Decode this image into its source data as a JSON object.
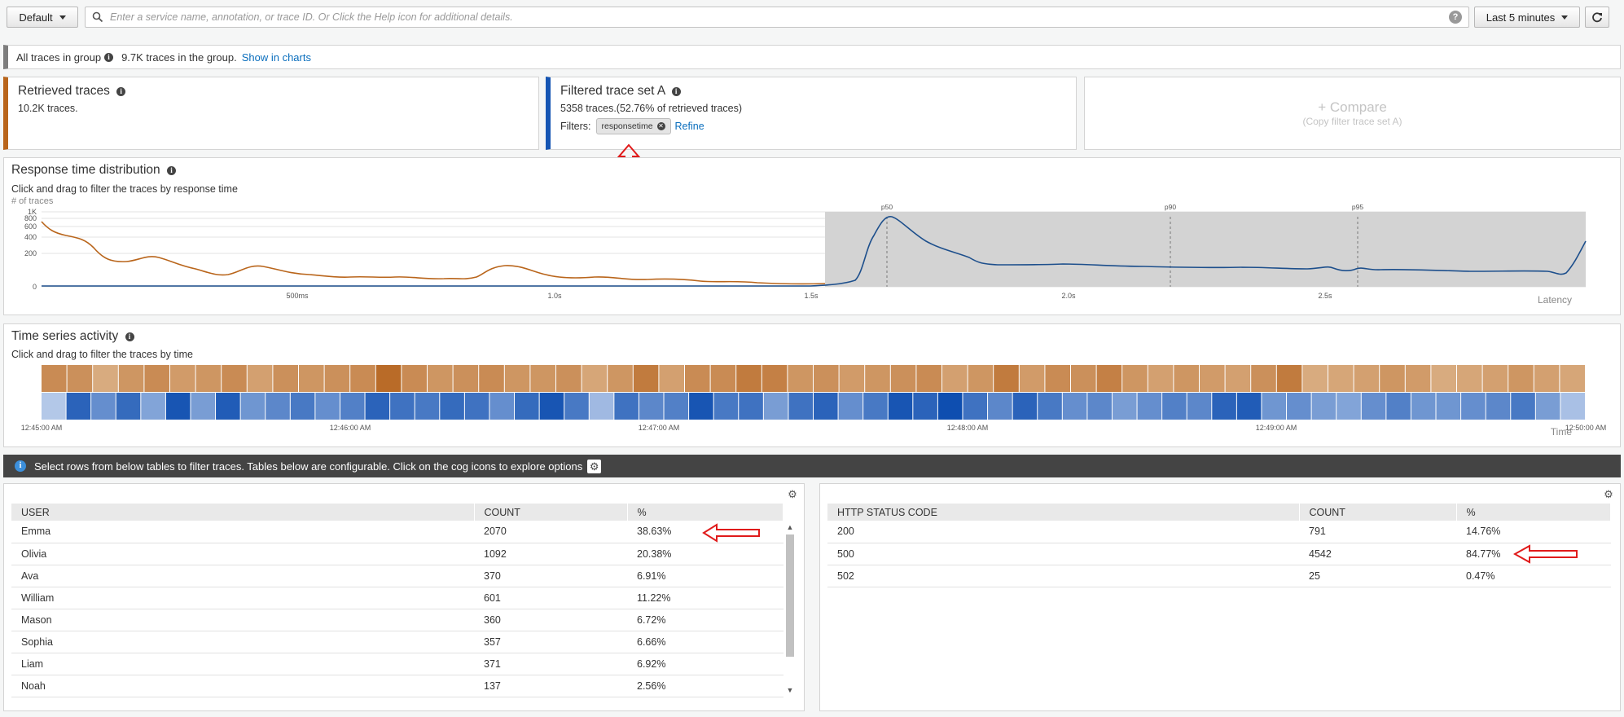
{
  "toolbar": {
    "group_label": "Default",
    "search_placeholder": "Enter a service name, annotation, or trace ID. Or Click the Help icon for additional details.",
    "help_label": "?",
    "time_range_label": "Last 5 minutes"
  },
  "group_bar": {
    "label": "All traces in group",
    "count_text": "9.7K traces in the group.",
    "link": "Show in charts"
  },
  "retrieved": {
    "title": "Retrieved traces",
    "count_text": "10.2K traces."
  },
  "filtered": {
    "title": "Filtered trace set A",
    "count_text": "5358 traces.(52.76% of retrieved traces)",
    "filters_label": "Filters:",
    "filter_chip": "responsetime",
    "refine_link": "Refine"
  },
  "compare": {
    "label": "+ Compare",
    "sub": "(Copy filter trace set A)"
  },
  "response_dist": {
    "title": "Response time distribution",
    "hint": "Click and drag to filter the traces by response time",
    "ylabel": "# of traces",
    "xlabel": "Latency",
    "yticks": [
      "1K",
      "800",
      "600",
      "400",
      "200",
      "0"
    ],
    "xticks": [
      "500ms",
      "1.0s",
      "1.5s",
      "2.0s",
      "2.5s"
    ],
    "percentiles": [
      "p50",
      "p90",
      "p95"
    ],
    "colors": {
      "retrieved": "#b9651b",
      "filtered": "#1d4f8c"
    }
  },
  "time_series": {
    "title": "Time series activity",
    "hint": "Click and drag to filter the traces by time",
    "xlabel": "Time",
    "xticks": [
      "12:45:00 AM",
      "12:46:00 AM",
      "12:47:00 AM",
      "12:48:00 AM",
      "12:49:00 AM",
      "12:50:00 AM"
    ],
    "retrieved_levels": [
      0.6,
      0.55,
      0.3,
      0.5,
      0.6,
      0.45,
      0.5,
      0.6,
      0.4,
      0.55,
      0.5,
      0.55,
      0.6,
      0.9,
      0.6,
      0.5,
      0.55,
      0.6,
      0.5,
      0.5,
      0.55,
      0.35,
      0.5,
      0.75,
      0.4,
      0.6,
      0.6,
      0.75,
      0.7,
      0.5,
      0.55,
      0.45,
      0.5,
      0.55,
      0.6,
      0.4,
      0.5,
      0.75,
      0.45,
      0.6,
      0.55,
      0.7,
      0.5,
      0.4,
      0.5,
      0.45,
      0.4,
      0.55,
      0.75,
      0.3,
      0.35,
      0.4,
      0.5,
      0.45,
      0.3,
      0.35,
      0.4,
      0.5,
      0.4,
      0.35
    ],
    "filtered_levels": [
      0.15,
      0.85,
      0.55,
      0.8,
      0.4,
      0.95,
      0.45,
      0.9,
      0.5,
      0.6,
      0.7,
      0.55,
      0.65,
      0.85,
      0.75,
      0.7,
      0.8,
      0.75,
      0.55,
      0.8,
      0.95,
      0.7,
      0.25,
      0.75,
      0.6,
      0.65,
      0.95,
      0.7,
      0.75,
      0.45,
      0.75,
      0.85,
      0.55,
      0.7,
      0.95,
      0.85,
      1.0,
      0.75,
      0.6,
      0.85,
      0.7,
      0.55,
      0.6,
      0.45,
      0.55,
      0.65,
      0.6,
      0.85,
      0.9,
      0.5,
      0.55,
      0.45,
      0.4,
      0.55,
      0.65,
      0.5,
      0.5,
      0.55,
      0.6,
      0.7,
      0.45,
      0.2
    ]
  },
  "info_bar": {
    "text": "Select rows from below tables to filter traces. Tables below are configurable. Click on the cog icons to explore options"
  },
  "user_table": {
    "headers": [
      "USER",
      "COUNT",
      "%"
    ],
    "rows": [
      {
        "name": "Emma",
        "count": "2070",
        "pct": "38.63%"
      },
      {
        "name": "Olivia",
        "count": "1092",
        "pct": "20.38%"
      },
      {
        "name": "Ava",
        "count": "370",
        "pct": "6.91%"
      },
      {
        "name": "William",
        "count": "601",
        "pct": "11.22%"
      },
      {
        "name": "Mason",
        "count": "360",
        "pct": "6.72%"
      },
      {
        "name": "Sophia",
        "count": "357",
        "pct": "6.66%"
      },
      {
        "name": "Liam",
        "count": "371",
        "pct": "6.92%"
      },
      {
        "name": "Noah",
        "count": "137",
        "pct": "2.56%"
      }
    ]
  },
  "status_table": {
    "headers": [
      "HTTP STATUS CODE",
      "COUNT",
      "%"
    ],
    "rows": [
      {
        "code": "200",
        "count": "791",
        "pct": "14.76%"
      },
      {
        "code": "500",
        "count": "4542",
        "pct": "84.77%"
      },
      {
        "code": "502",
        "count": "25",
        "pct": "0.47%"
      }
    ]
  },
  "annotation_color": "#e01b1b"
}
